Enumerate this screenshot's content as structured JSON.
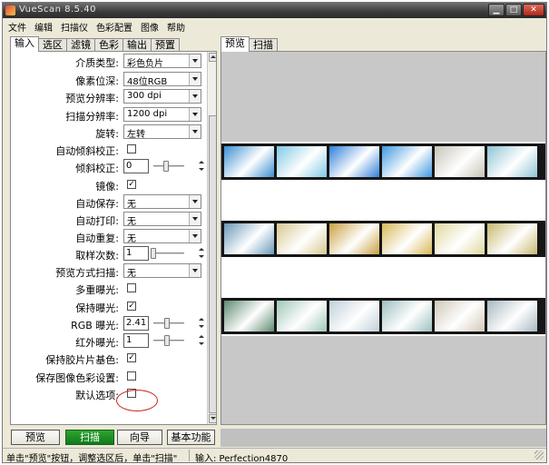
{
  "window": {
    "title": "VueScan 8.5.40"
  },
  "titlebar_buttons": [
    {
      "name": "minimize-button",
      "glyph": "▁"
    },
    {
      "name": "maximize-button",
      "glyph": "□"
    },
    {
      "name": "close-button",
      "glyph": "✕"
    }
  ],
  "menu": [
    "文件",
    "编辑",
    "扫描仪",
    "色彩配置",
    "图像",
    "帮助"
  ],
  "left_tabs": [
    {
      "label": "输入",
      "active": true
    },
    {
      "label": "选区",
      "active": false
    },
    {
      "label": "滤镜",
      "active": false
    },
    {
      "label": "色彩",
      "active": false
    },
    {
      "label": "输出",
      "active": false
    },
    {
      "label": "预置",
      "active": false
    }
  ],
  "right_tabs": [
    {
      "label": "预览",
      "active": true
    },
    {
      "label": "扫描",
      "active": false
    }
  ],
  "settings": [
    {
      "label": "介质类型:",
      "type": "combo",
      "value": "彩色负片"
    },
    {
      "label": "像素位深:",
      "type": "combo",
      "value": "48位RGB"
    },
    {
      "label": "预览分辨率:",
      "type": "combo",
      "value": "300 dpi"
    },
    {
      "label": "扫描分辨率:",
      "type": "combo",
      "value": "1200 dpi"
    },
    {
      "label": "旋转:",
      "type": "combo",
      "value": "左转"
    },
    {
      "label": "自动倾斜校正:",
      "type": "check",
      "checked": false
    },
    {
      "label": "倾斜校正:",
      "type": "spin",
      "value": "0",
      "slider_fraction": 0.4
    },
    {
      "label": "镜像:",
      "type": "check",
      "checked": true
    },
    {
      "label": "自动保存:",
      "type": "combo",
      "value": "无"
    },
    {
      "label": "自动打印:",
      "type": "combo",
      "value": "无"
    },
    {
      "label": "自动重复:",
      "type": "combo",
      "value": "无"
    },
    {
      "label": "取样次数:",
      "type": "spin",
      "value": "1",
      "slider_fraction": 0.0
    },
    {
      "label": "预览方式扫描:",
      "type": "combo",
      "value": "无"
    },
    {
      "label": "多重曝光:",
      "type": "check",
      "checked": false
    },
    {
      "label": "保持曝光:",
      "type": "check",
      "checked": true
    },
    {
      "label": "RGB 曝光:",
      "type": "spin",
      "value": "2.41",
      "slider_fraction": 0.45
    },
    {
      "label": "红外曝光:",
      "type": "spin",
      "value": "1",
      "slider_fraction": 0.45
    },
    {
      "label": "保持胶片片基色:",
      "type": "check",
      "checked": true
    },
    {
      "label": "保存图像色彩设置:",
      "type": "check",
      "checked": false
    },
    {
      "label": "默认选项:",
      "type": "check",
      "checked": false
    }
  ],
  "check_glyph": "✓",
  "buttons": {
    "preview": "预览",
    "scan": "扫描",
    "guide": "向导",
    "basic": "基本功能"
  },
  "status": {
    "message": "单击\"预览\"按钮，调整选区后，单击\"扫描\"",
    "input": "输入: Perfection4870"
  },
  "film_strips": [
    {
      "frame_colors": [
        "#3a8fd0",
        "#7fc9e6",
        "#2f7fd8",
        "#3f97e0",
        "#c8c4b8",
        "#8ec4d4"
      ]
    },
    {
      "frame_colors": [
        "#6a98b8",
        "#d8c890",
        "#c8a040",
        "#d8b858",
        "#e0d8a0",
        "#c8b870"
      ]
    },
    {
      "frame_colors": [
        "#5e8a70",
        "#a0c8b8",
        "#c0d0d8",
        "#9ec0c0",
        "#d0c8b8",
        "#a8b8c0"
      ]
    }
  ]
}
